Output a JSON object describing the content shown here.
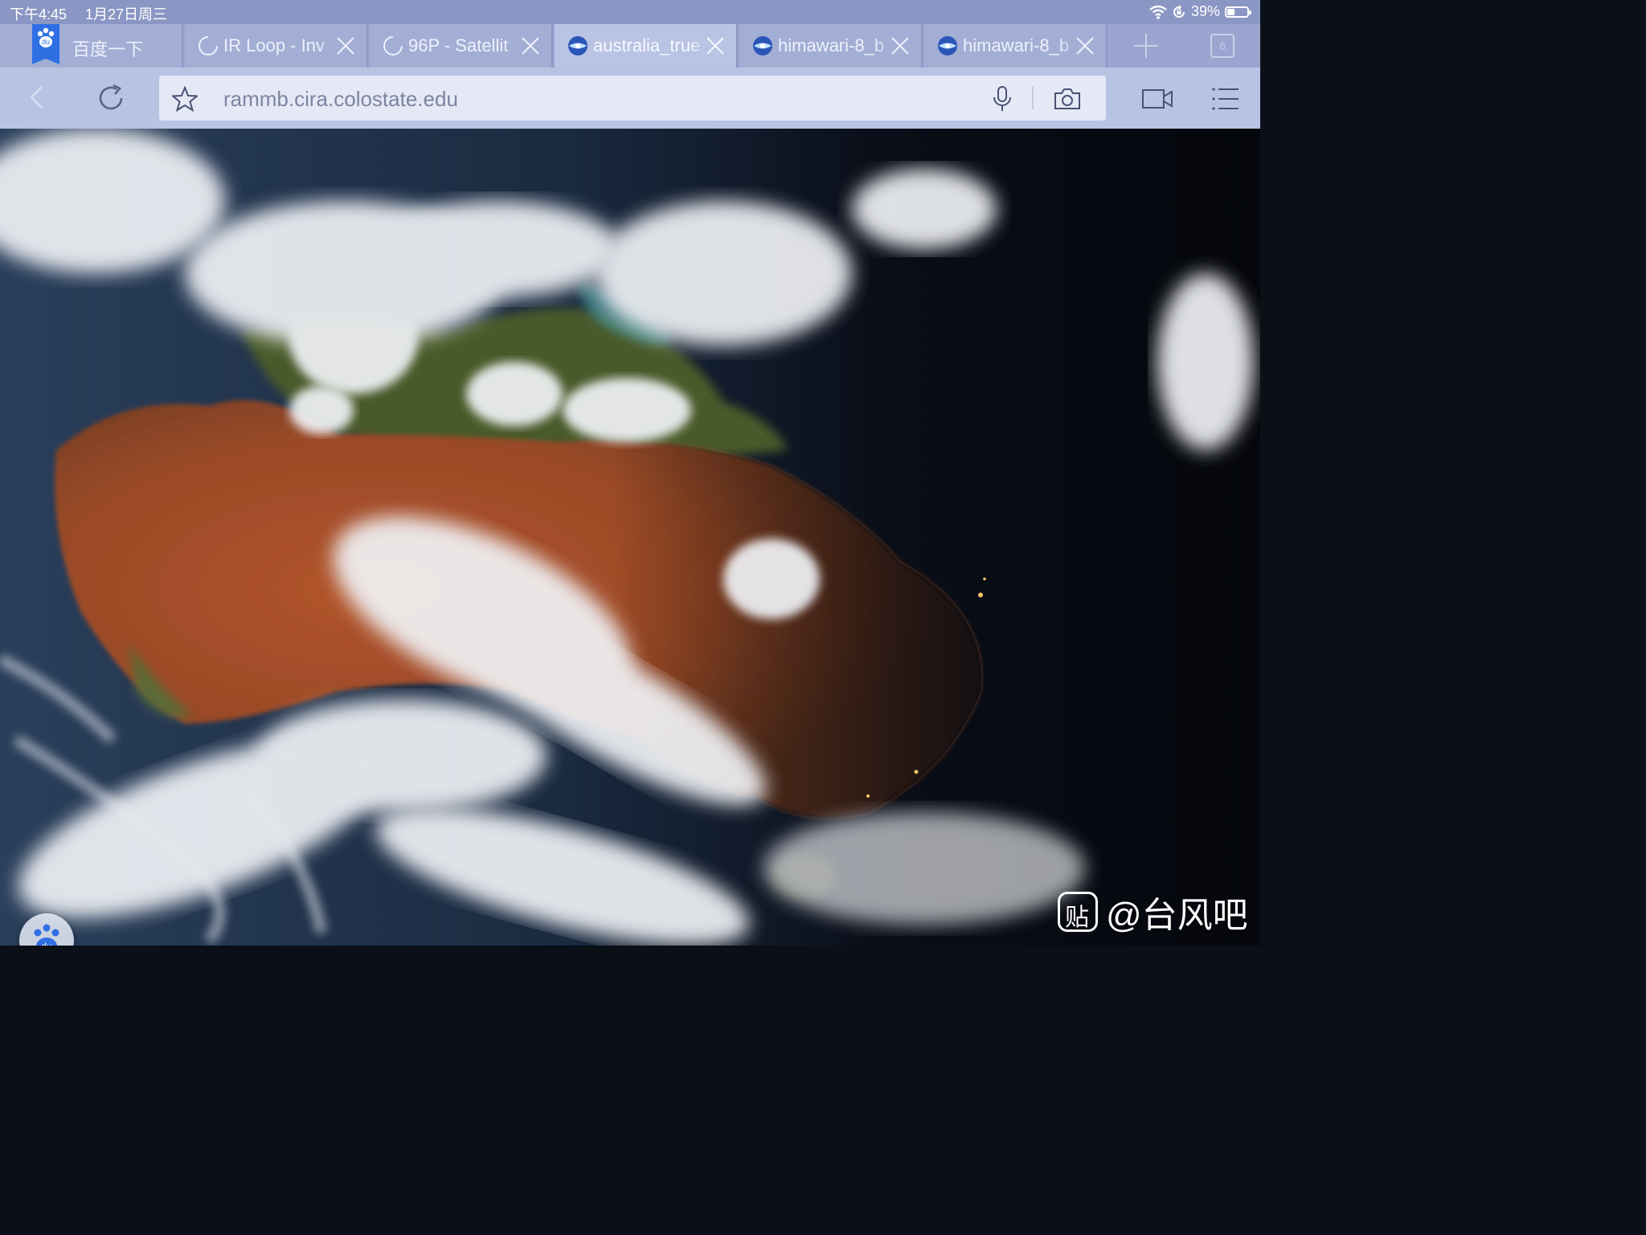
{
  "status_bar": {
    "time": "下午4:45",
    "date": "1月27日周三",
    "battery_percent": "39%",
    "battery_level": 0.39,
    "icons": [
      "wifi-icon",
      "orientation-lock-icon",
      "battery-icon"
    ]
  },
  "tabs": [
    {
      "label": "百度一下",
      "icon": "baidu-icon",
      "active": false
    },
    {
      "label": "IR Loop - Inv",
      "icon": "loading-spinner-icon",
      "active": false
    },
    {
      "label": "96P - Satellit",
      "icon": "loading-spinner-icon",
      "active": false
    },
    {
      "label": "australia_true",
      "icon": "globe-icon",
      "active": true
    },
    {
      "label": "himawari-8_b",
      "icon": "globe-icon",
      "active": false
    },
    {
      "label": "himawari-8_b",
      "icon": "globe-icon",
      "active": false
    }
  ],
  "tab_count": "6",
  "toolbar": {
    "url": "rammb.cira.colostate.edu"
  },
  "content": {
    "watermark_text": "@台风吧",
    "watermark_logo": "贴"
  },
  "colors": {
    "status_bar": "#8a96c3",
    "tab_strip": "#9aa6cf",
    "active_tab": "#b9c3e4",
    "toolbar": "#b7c3e3",
    "url_field": "#e5e9f5"
  }
}
